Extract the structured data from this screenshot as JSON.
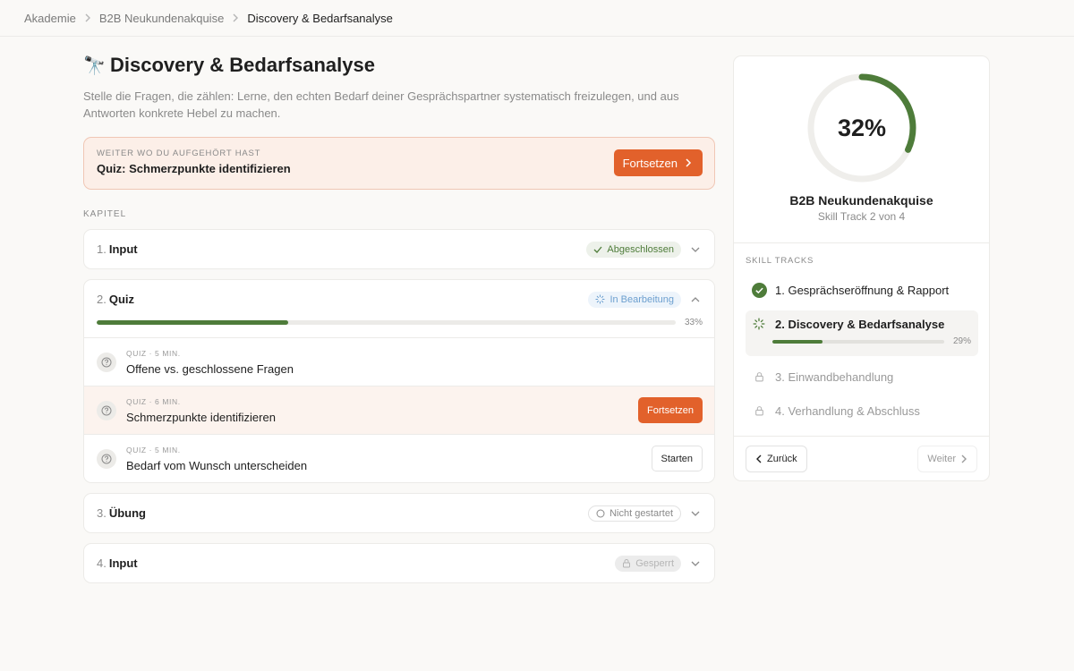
{
  "breadcrumb": [
    "Akademie",
    "B2B Neukundenakquise",
    "Discovery & Bedarfsanalyse"
  ],
  "page": {
    "emoji": "🔭",
    "title": "Discovery & Bedarfsanalyse",
    "subtitle": "Stelle die Fragen, die zählen: Lerne, den echten Bedarf deiner Gesprächspartner systematisch freizulegen, und aus Antworten konkrete Hebel zu machen."
  },
  "resume": {
    "eyebrow": "Weiter wo du aufgehört hast",
    "title": "Quiz: Schmerzpunkte identifizieren",
    "button": "Fortsetzen"
  },
  "chapters_label": "Kapitel",
  "chapters": [
    {
      "num": "1.",
      "name": "Input",
      "status": "Abgeschlossen"
    },
    {
      "num": "2.",
      "name": "Quiz",
      "status": "In Bearbeitung",
      "progress_pct": 33,
      "progress_label": "33%",
      "lessons": [
        {
          "meta": "Quiz · 5 Min.",
          "title": "Offene vs. geschlossene Fragen"
        },
        {
          "meta": "Quiz · 6 Min.",
          "title": "Schmerzpunkte identifizieren",
          "action": "Fortsetzen"
        },
        {
          "meta": "Quiz · 5 Min.",
          "title": "Bedarf vom Wunsch unterscheiden",
          "action": "Starten"
        }
      ]
    },
    {
      "num": "3.",
      "name": "Übung",
      "status": "Nicht gestartet"
    },
    {
      "num": "4.",
      "name": "Input",
      "status": "Gesperrt"
    }
  ],
  "aside": {
    "progress_pct": 32,
    "progress_label": "32%",
    "track_title": "B2B Neukundenakquise",
    "track_sub": "Skill Track 2 von 4",
    "tracks_label": "Skill Tracks",
    "tracks": [
      {
        "label": "1. Gesprächseröffnung & Rapport",
        "state": "done"
      },
      {
        "label": "2. Discovery & Bedarfsanalyse",
        "state": "current",
        "progress_pct": 29,
        "progress_label": "29%"
      },
      {
        "label": "3. Einwandbehandlung",
        "state": "locked"
      },
      {
        "label": "4. Verhandlung & Abschluss",
        "state": "locked"
      }
    ],
    "back": "Zurück",
    "next": "Weiter"
  },
  "colors": {
    "accent": "#e2612b",
    "success": "#4e7c3a",
    "info": "#6c9fcf"
  }
}
